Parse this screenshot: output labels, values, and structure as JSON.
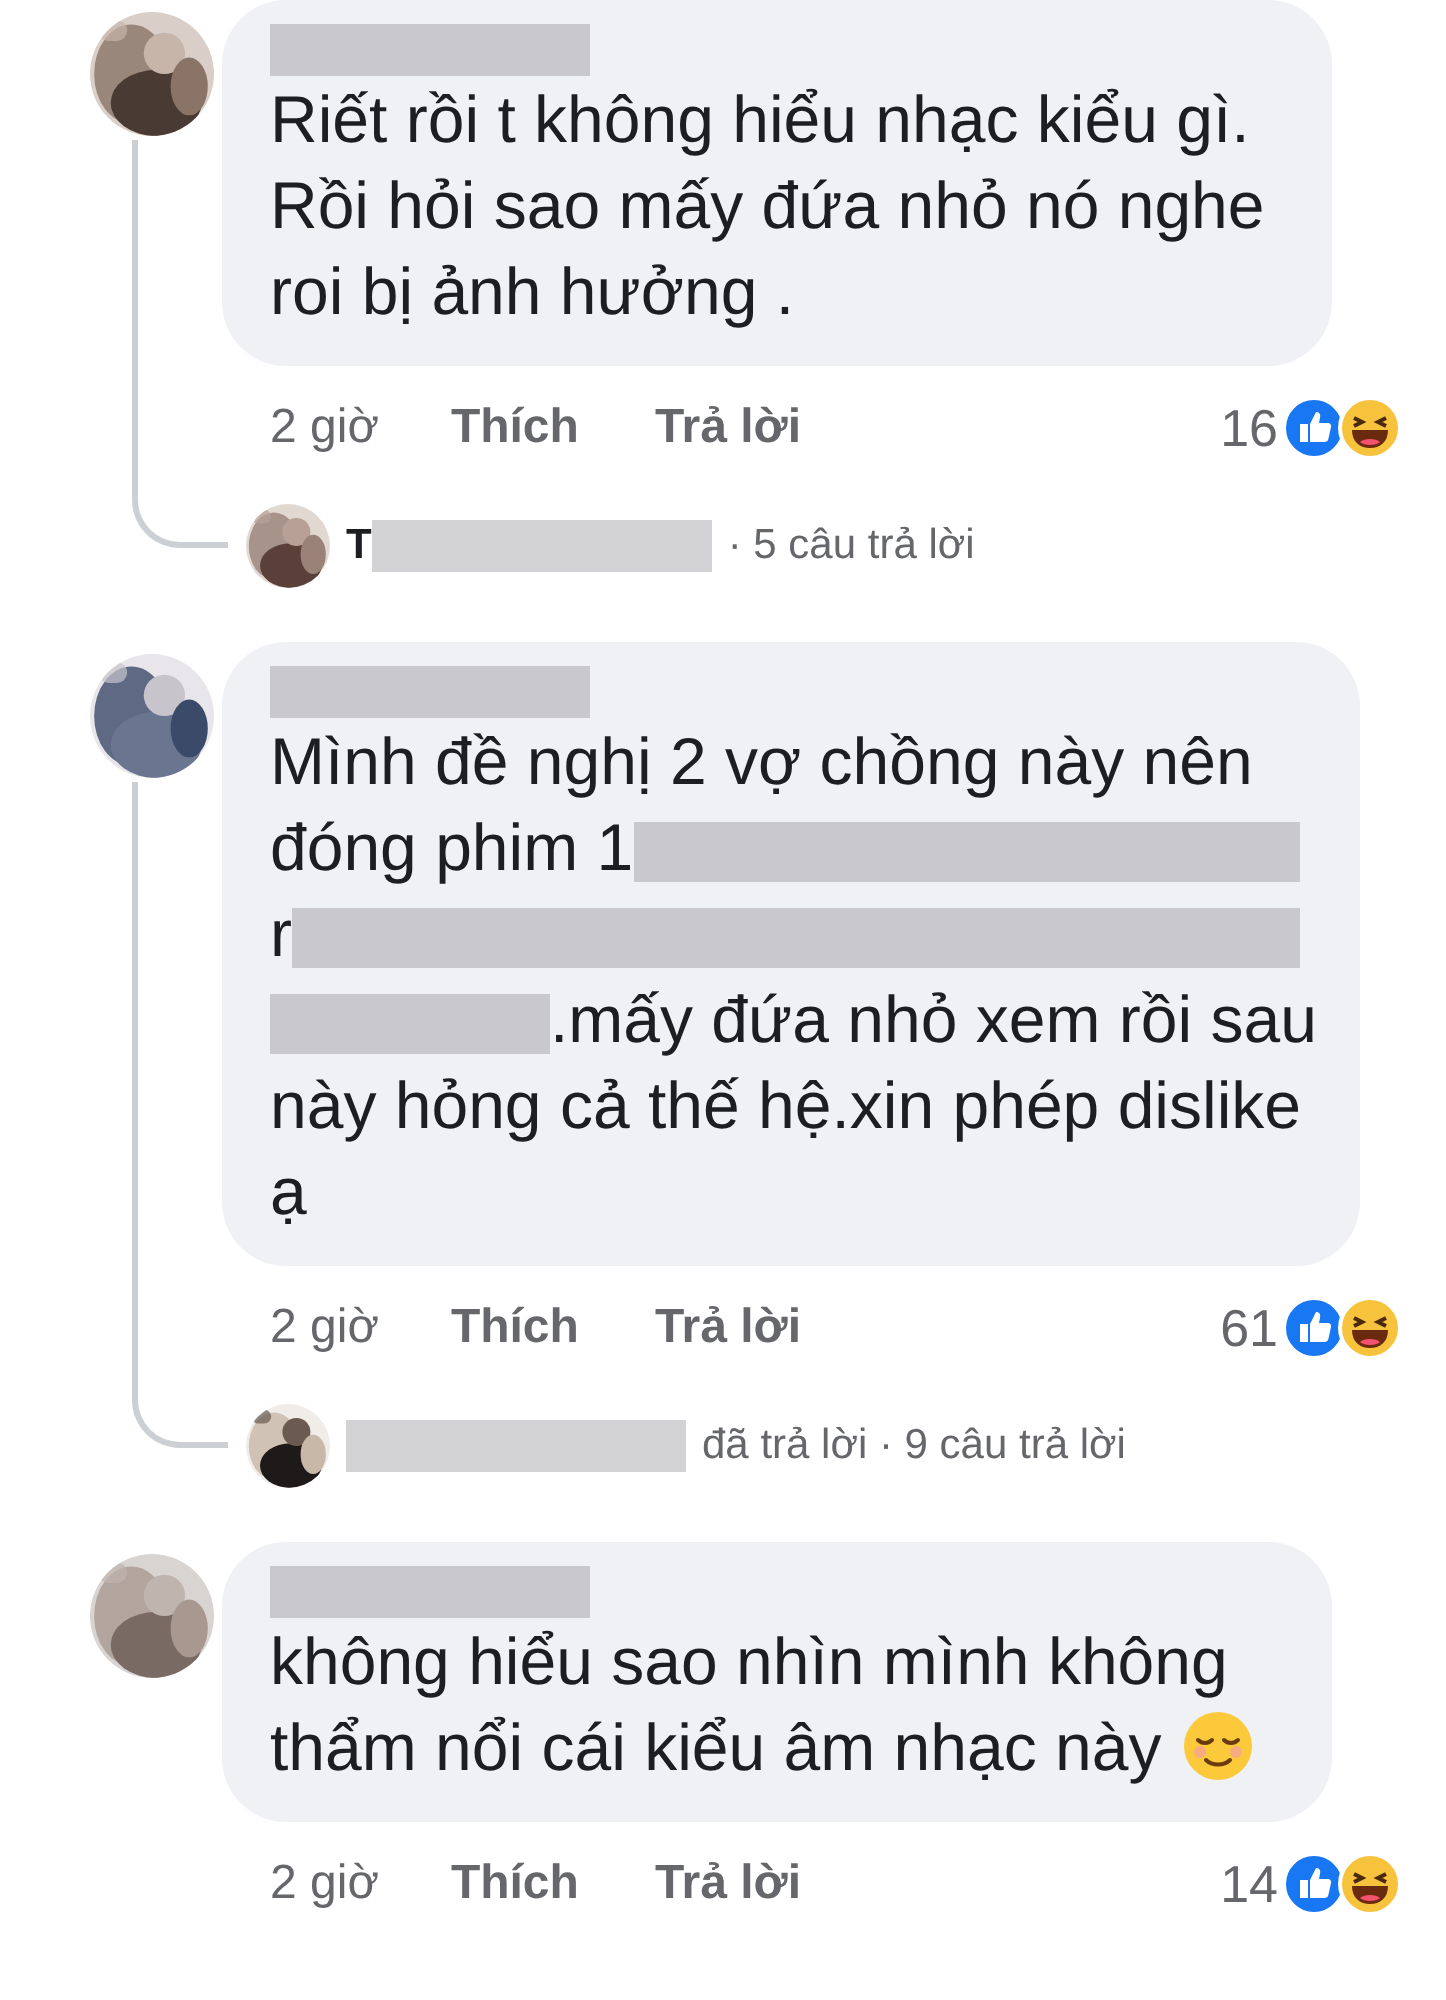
{
  "comments": [
    {
      "author_redacted": true,
      "body": [
        {
          "kind": "text",
          "text": "Riết rồi t không hiểu nhạc kiểu gì.\nRồi hỏi sao mấy đứa nhỏ nó nghe\nroi bị ảnh hưởng ."
        }
      ],
      "time": "2 giờ",
      "like": "Thích",
      "reply": "Trả lời",
      "count": "16",
      "reactions": [
        {
          "kind": "like"
        },
        {
          "kind": "haha"
        }
      ],
      "replies": {
        "segments": [
          {
            "kind": "text",
            "text": "T"
          },
          {
            "kind": "redacted"
          },
          {
            "kind": "text",
            "text": "· 5 câu trả lời"
          }
        ]
      }
    },
    {
      "author_redacted": true,
      "body": [
        {
          "kind": "text",
          "text": "Mình đề nghị 2 vợ chồng này nên"
        },
        {
          "kind": "break"
        },
        {
          "kind": "text",
          "text": "đóng phim 1"
        },
        {
          "kind": "redacted"
        },
        {
          "kind": "break"
        },
        {
          "kind": "text",
          "text": "r"
        },
        {
          "kind": "redacted"
        },
        {
          "kind": "break"
        },
        {
          "kind": "redacted"
        },
        {
          "kind": "text",
          "text": ".mấy đứa nhỏ xem rồi sau"
        },
        {
          "kind": "break"
        },
        {
          "kind": "text",
          "text": "này hỏng cả thế hệ.xin phép dislike\nạ"
        }
      ],
      "time": "2 giờ",
      "like": "Thích",
      "reply": "Trả lời",
      "count": "61",
      "reactions": [
        {
          "kind": "like"
        },
        {
          "kind": "haha"
        }
      ],
      "replies": {
        "segments": [
          {
            "kind": "redacted"
          },
          {
            "kind": "text",
            "text": "đã trả lời · 9 câu trả lời"
          }
        ]
      }
    },
    {
      "author_redacted": true,
      "body": [
        {
          "kind": "text",
          "text": "không hiểu sao nhìn mình không"
        },
        {
          "kind": "break"
        },
        {
          "kind": "text",
          "text": "thẩm nổi cái kiểu âm nhạc này"
        },
        {
          "kind": "emoji"
        }
      ],
      "time": "2 giờ",
      "like": "Thích",
      "reply": "Trả lời",
      "count": "14",
      "reactions": [
        {
          "kind": "like"
        },
        {
          "kind": "haha"
        }
      ]
    }
  ]
}
